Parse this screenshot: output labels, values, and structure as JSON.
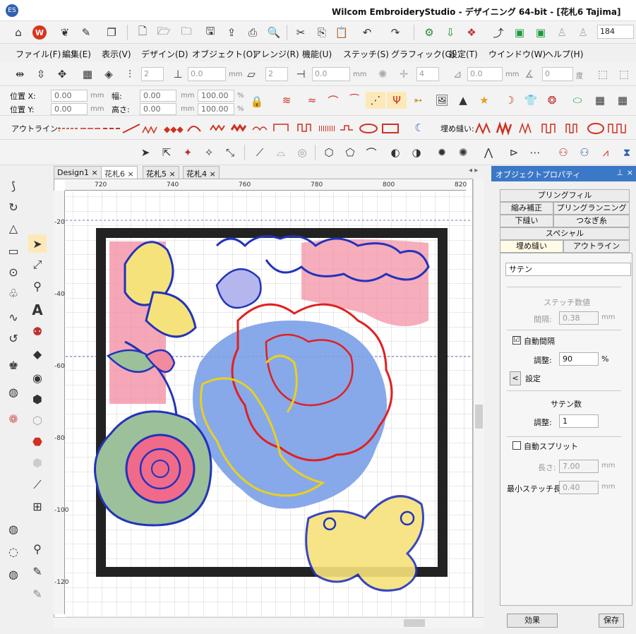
{
  "app": {
    "title": "Wilcom EmbroideryStudio - デザイニング 64-bit - [花札6     Tajima]",
    "icon_text": "ES",
    "colors": {
      "accent": "#3c78c8",
      "red_logo": "#d8341c"
    }
  },
  "toolbar": {
    "zoom_value": "184",
    "icons": [
      "home-icon",
      "wilcom-logo-icon",
      "balloon-icon",
      "wand-icon",
      "copy-pages-icon",
      "new-file-icon",
      "open-folder-icon",
      "open-recent-icon",
      "save-icon",
      "export-icon",
      "print-icon",
      "preview-icon",
      "cut-icon",
      "copy-icon",
      "paste-icon",
      "undo-icon",
      "redo-icon"
    ]
  },
  "menu": {
    "items": [
      "ファイル(F)",
      "編集(E)",
      "表示(V)",
      "デザイン(D)",
      "オブジェクト(O)",
      "アレンジ(R)",
      "機能(U)",
      "ステッチ(S)",
      "グラフィック(G)",
      "設定(T)",
      "ウインドウ(W)",
      "ヘルプ(H)"
    ]
  },
  "transform_bar": {
    "count1": "2",
    "dist1": "0.0",
    "unit_mm": "mm",
    "count2": "2",
    "dist2": "0.0",
    "count3": "4",
    "dist3": "0.0",
    "angle": "0",
    "degree": "度"
  },
  "position_bar": {
    "pos_x_label": "位置 X:",
    "pos_y_label": "位置 Y:",
    "pos_x": "0.00",
    "pos_y": "0.00",
    "unit": "mm",
    "width_label": "幅:",
    "height_label": "高さ:",
    "width": "0.00",
    "height": "0.00",
    "width_pct": "100.00",
    "height_pct": "100.00",
    "pct": "%"
  },
  "stitch_bar": {
    "outline_label": "アウトライン:",
    "fill_label": "埋め縫い:"
  },
  "tabs": [
    {
      "label": "Design1",
      "close": "×"
    },
    {
      "label": "花札6",
      "close": "×"
    },
    {
      "label": "花札5",
      "close": "×"
    },
    {
      "label": "花札4",
      "close": "×"
    }
  ],
  "ruler": {
    "top": [
      "720",
      "740",
      "760",
      "780",
      "800",
      "820"
    ],
    "left": [
      "-20",
      "-40",
      "-60",
      "-80",
      "-100",
      "-120"
    ]
  },
  "properties": {
    "title": "オブジェクトプロパティ",
    "tabs_row1": [
      "プリングフィル"
    ],
    "tabs_row2": [
      "縮み補正",
      "プリングランニング"
    ],
    "tabs_row3": [
      "下縫い",
      "つなぎ糸"
    ],
    "tabs_row4": [
      "スペシャル"
    ],
    "tabs_row5": [
      "埋め縫い",
      "アウトライン"
    ],
    "stitch_type": "サテン",
    "stitch_values_label": "ステッチ数値",
    "spacing_label": "間隔:",
    "spacing_value": "0.38",
    "unit_mm": "mm",
    "auto_spacing_label": "自動間隔",
    "auto_spacing_checked": "☑",
    "adjust_label": "調整:",
    "adjust_value": "90",
    "percent": "%",
    "settings_label": "設定",
    "settings_arrow": "<",
    "satin_count_label": "サテン数",
    "satin_adjust_label": "調整:",
    "satin_adjust_value": "1",
    "auto_split_label": "自動スプリット",
    "length_label": "長さ:",
    "length_value": "7.00",
    "min_stitch_label": "最小ステッチ長:",
    "min_stitch_value": "0.40",
    "effect_button": "効果",
    "save_button": "保存"
  }
}
